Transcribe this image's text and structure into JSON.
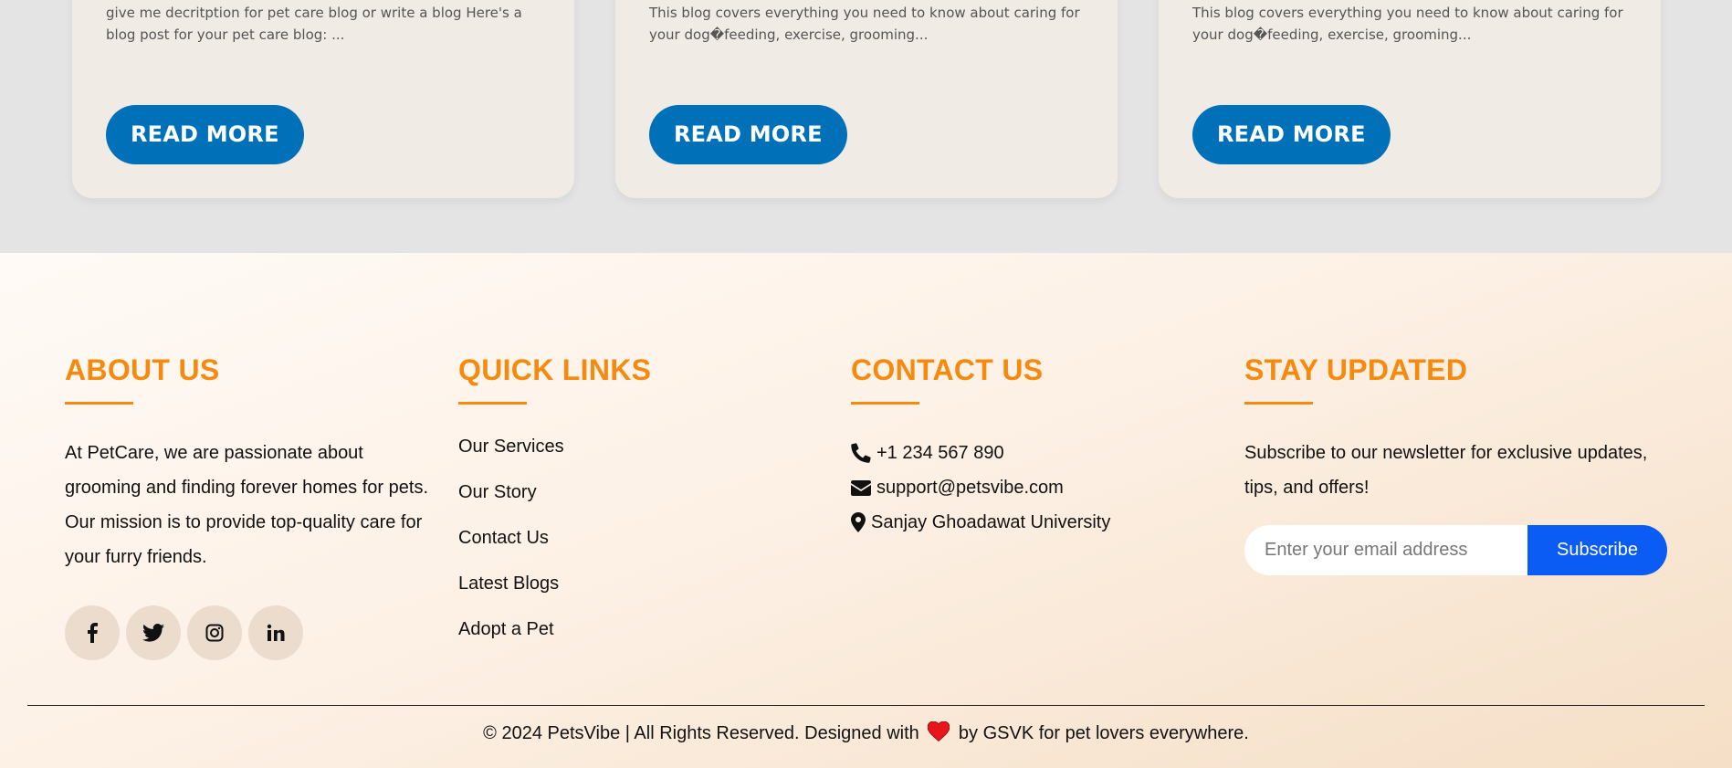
{
  "blog_cards": [
    {
      "description": "give me decritption for pet care blog or write a blog Here's a blog post for your pet care blog: ...",
      "button_label": "READ MORE"
    },
    {
      "description": "This blog covers everything you need to know about caring for your dog�feeding, exercise, grooming...",
      "button_label": "READ MORE"
    },
    {
      "description": "This blog covers everything you need to know about caring for your dog�feeding, exercise, grooming...",
      "button_label": "READ MORE"
    }
  ],
  "footer": {
    "about": {
      "heading": "ABOUT US",
      "text": "At PetCare, we are passionate about grooming and finding forever homes for pets. Our mission is to provide top-quality care for your furry friends.",
      "socials": [
        {
          "icon": "facebook-icon"
        },
        {
          "icon": "twitter-icon"
        },
        {
          "icon": "instagram-icon"
        },
        {
          "icon": "linkedin-icon"
        }
      ]
    },
    "quick_links": {
      "heading": "QUICK LINKS",
      "items": [
        "Our Services",
        "Our Story",
        "Contact Us",
        "Latest Blogs",
        "Adopt a Pet"
      ]
    },
    "contact": {
      "heading": "CONTACT US",
      "phone": "+1 234 567 890",
      "email": "support@petsvibe.com",
      "address": "Sanjay Ghoadawat University"
    },
    "stay_updated": {
      "heading": "STAY UPDATED",
      "text": "Subscribe to our newsletter for exclusive updates, tips, and offers!",
      "email_placeholder": "Enter your email address",
      "subscribe_label": "Subscribe"
    },
    "copyright_before": "© 2024 PetsVibe | All Rights Reserved. Designed with",
    "copyright_after": "by GSVK for pet lovers everywhere."
  },
  "colors": {
    "accent_orange": "#f58a0f",
    "button_blue": "#0071b8",
    "subscribe_blue": "#0b5bf5",
    "heart_red": "#e8161b"
  }
}
